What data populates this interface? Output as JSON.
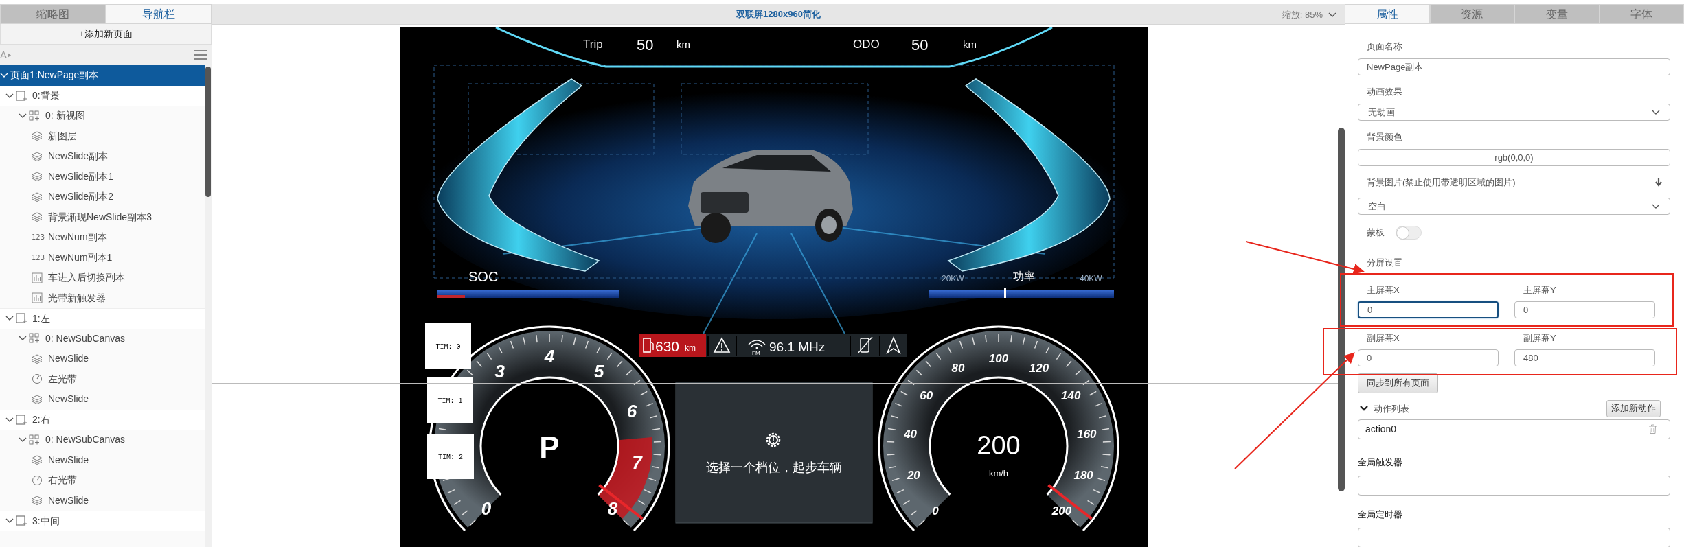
{
  "left_panel": {
    "tabs": [
      {
        "label": "缩略图",
        "selected": false
      },
      {
        "label": "导航栏",
        "selected": true
      }
    ],
    "add_page_button": "+添加新页面",
    "font_tool": "A",
    "tree": [
      {
        "label": "页面1:NewPage副本",
        "kind": "page",
        "expanded": true,
        "selected": true,
        "children": [
          {
            "label": "0:背景",
            "kind": "screen",
            "expanded": true,
            "selected": false,
            "children": [
              {
                "label": "0: 新视图",
                "kind": "view",
                "expanded": true,
                "selected": false,
                "children": [
                  {
                    "label": "新图层",
                    "kind": "layer",
                    "selected": false
                  },
                  {
                    "label": "NewSlide副本",
                    "kind": "layer",
                    "selected": false
                  },
                  {
                    "label": "NewSlide副本1",
                    "kind": "layer",
                    "selected": false
                  },
                  {
                    "label": "NewSlide副本2",
                    "kind": "layer",
                    "selected": false
                  },
                  {
                    "label": "背景渐现NewSlide副本3",
                    "kind": "layer",
                    "selected": false
                  },
                  {
                    "label": "NewNum副本",
                    "kind": "number",
                    "icon_text": "123",
                    "selected": false
                  },
                  {
                    "label": "NewNum副本1",
                    "kind": "number",
                    "icon_text": "123",
                    "selected": false
                  },
                  {
                    "label": "车进入后切换副本",
                    "kind": "chart",
                    "selected": false
                  },
                  {
                    "label": "光带新触发器",
                    "kind": "chart",
                    "selected": false
                  }
                ]
              }
            ]
          },
          {
            "label": "1:左",
            "kind": "screen",
            "expanded": true,
            "selected": false,
            "children": [
              {
                "label": "0: NewSubCanvas",
                "kind": "view",
                "expanded": true,
                "selected": false,
                "children": [
                  {
                    "label": "NewSlide",
                    "kind": "layer",
                    "selected": false
                  },
                  {
                    "label": "左光带",
                    "kind": "gauge",
                    "selected": false
                  },
                  {
                    "label": "NewSlide",
                    "kind": "layer",
                    "selected": false
                  }
                ]
              }
            ]
          },
          {
            "label": "2:右",
            "kind": "screen",
            "expanded": true,
            "selected": false,
            "children": [
              {
                "label": "0: NewSubCanvas",
                "kind": "view",
                "expanded": true,
                "selected": false,
                "children": [
                  {
                    "label": "NewSlide",
                    "kind": "layer",
                    "selected": false
                  },
                  {
                    "label": "右光带",
                    "kind": "gauge",
                    "selected": false
                  },
                  {
                    "label": "NewSlide",
                    "kind": "layer",
                    "selected": false
                  }
                ]
              }
            ]
          },
          {
            "label": "3:中间",
            "kind": "screen",
            "expanded": true,
            "selected": false
          }
        ]
      }
    ]
  },
  "editor": {
    "title": "双联屏1280x960简化",
    "zoom": "缩放: 85%"
  },
  "dashboard": {
    "trip": {
      "label": "Trip",
      "value": "50",
      "unit": "km"
    },
    "odo": {
      "label": "ODO",
      "value": "50",
      "unit": "km"
    },
    "soc_label": "SOC",
    "power": {
      "min_label": "-20KW",
      "label": "功率",
      "max_label": "40KW"
    },
    "timers": [
      "TIM: 0",
      "TIM: 1",
      "TIM: 2"
    ],
    "status_bar": {
      "range_value": "630",
      "range_unit": "km",
      "radio_band": "FM",
      "radio_frequency": "96.1 MHz"
    },
    "tachometer": {
      "gear": "P",
      "ticks": [
        "0",
        "3",
        "4",
        "5",
        "6",
        "7",
        "8"
      ]
    },
    "message": "选择一个档位，起步车辆",
    "speedometer": {
      "value": "200",
      "unit": "km/h",
      "ticks": [
        "0",
        "20",
        "40",
        "60",
        "80",
        "100",
        "120",
        "140",
        "160",
        "180",
        "200"
      ]
    }
  },
  "right_panel": {
    "tabs": [
      {
        "label": "属性",
        "selected": true
      },
      {
        "label": "资源",
        "selected": false
      },
      {
        "label": "变量",
        "selected": false
      },
      {
        "label": "字体",
        "selected": false
      }
    ],
    "page_name": {
      "label": "页面名称",
      "value": "NewPage副本"
    },
    "animation": {
      "label": "动画效果",
      "value": "无动画"
    },
    "background_color": {
      "label": "背景颜色",
      "value": "rgb(0,0,0)"
    },
    "background_image": {
      "label": "背景图片(禁止使用带透明区域的图片)",
      "value": "空白"
    },
    "mask": {
      "label": "蒙板",
      "on": false
    },
    "split_screen": {
      "label": "分屏设置",
      "fields": [
        {
          "label": "主屏幕X",
          "value": "0",
          "focused": true
        },
        {
          "label": "主屏幕Y",
          "value": "0",
          "focused": false
        },
        {
          "label": "副屏幕X",
          "value": "0",
          "focused": false
        },
        {
          "label": "副屏幕Y",
          "value": "480",
          "focused": false
        }
      ]
    },
    "sync_button": "同步到所有页面",
    "actions": {
      "label": "动作列表",
      "expanded": true,
      "add_button": "添加新动作",
      "items": [
        "action0"
      ]
    },
    "global_trigger": {
      "label": "全局触发器"
    },
    "global_timer": {
      "label": "全局定时器"
    }
  }
}
